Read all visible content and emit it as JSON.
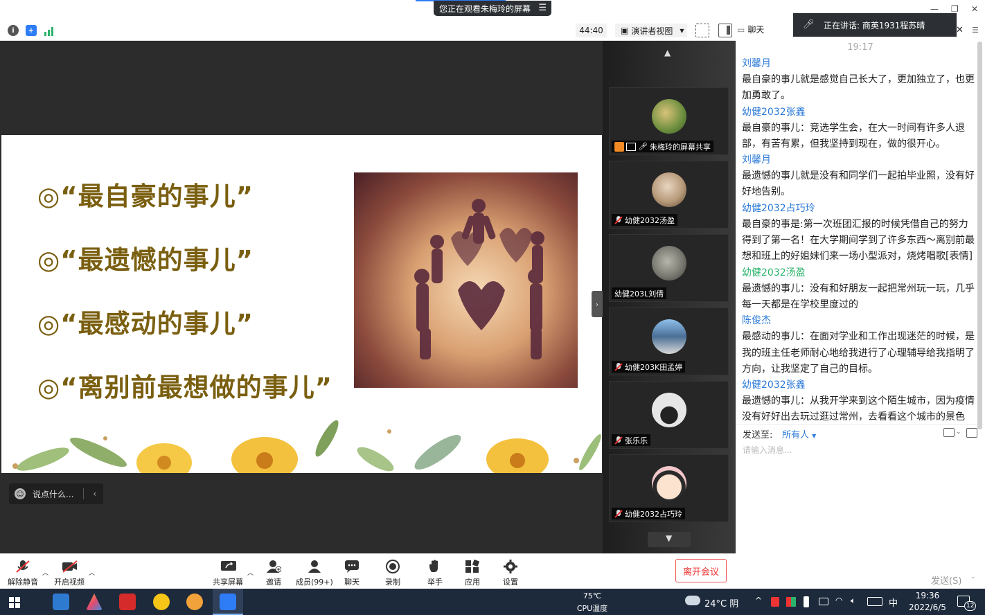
{
  "window": {
    "share_banner": "您正在观看朱梅玲的屏幕",
    "timer": "44:40",
    "view_mode": "演讲者视图",
    "chat_tab": "聊天",
    "speaking": "正在讲话: 商英1931程苏晴"
  },
  "slide": {
    "items": [
      "◎“最自豪的事儿”",
      "◎“最遗憾的事儿”",
      "◎“最感动的事儿”",
      "◎“离别前最想做的事儿”"
    ]
  },
  "stage": {
    "say_placeholder": "说点什么..."
  },
  "participants": [
    {
      "name": "朱梅玲的屏幕共享",
      "avatar_color": "#6b8e3d"
    },
    {
      "name": "幼健2032汤盈",
      "avatar_color": "#b79a7a"
    },
    {
      "name": "幼健203L刘倩",
      "avatar_color": "#7a7a72"
    },
    {
      "name": "幼健203K田孟婷",
      "avatar_color": "#4b6f96"
    },
    {
      "name": "张乐乐",
      "avatar_color": "#e6e6e6"
    },
    {
      "name": "幼健2032占巧玲",
      "avatar_color": "#f2c6c9"
    }
  ],
  "chat": {
    "time": "19:17",
    "messages": [
      {
        "sender": "刘馨月",
        "text": "最自豪的事儿就是感觉自己长大了，更加独立了，也更加勇敢了。"
      },
      {
        "sender": "幼健2032张鑫",
        "text": "最自豪的事儿：竞选学生会，在大一时间有许多人退部，有苦有累，但我坚持到现在，做的很开心。"
      },
      {
        "sender": "刘馨月",
        "text": "最遗憾的事儿就是没有和同学们一起拍毕业照，没有好好地告别。"
      },
      {
        "sender": "幼健2032占巧玲",
        "text": "最自豪的事是:第一次班团汇报的时候凭借自己的努力得到了第一名！在大学期间学到了许多东西～离别前最想和班上的好姐妹们来一场小型派对，烧烤唱歌[表情]"
      },
      {
        "sender": "幼健2032汤盈",
        "text": "最遗憾的事儿：没有和好朋友一起把常州玩一玩，几乎每一天都是在学校里度过的",
        "green": true
      },
      {
        "sender": "陈俊杰",
        "text": "最感动的事儿：在面对学业和工作出现迷茫的时候，是我的班主任老师耐心地给我进行了心理辅导给我指明了方向，让我坚定了自己的目标。"
      },
      {
        "sender": "幼健2032张鑫",
        "text": "最遗憾的事儿：从我开学来到这个陌生城市，因为疫情没有好好出去玩过逛过常州，去看看这个城市的景色"
      }
    ],
    "send_to_label": "发送至:",
    "send_to_value": "所有人",
    "input_placeholder": "请输入消息...",
    "send_button": "发送(S)"
  },
  "toolbar": {
    "unmute": "解除静音",
    "start_video": "开启视频",
    "share_screen": "共享屏幕",
    "invite": "邀请",
    "members": "成员(99+)",
    "chat": "聊天",
    "record": "录制",
    "raise_hand": "举手",
    "apps": "应用",
    "settings": "设置",
    "leave": "离开会议"
  },
  "taskbar": {
    "cpu_temp": "75℃",
    "cpu_label": "CPU温度",
    "weather": "24°C 阴",
    "ime": "中",
    "time": "19:36",
    "date": "2022/6/5",
    "notifications": "12"
  }
}
